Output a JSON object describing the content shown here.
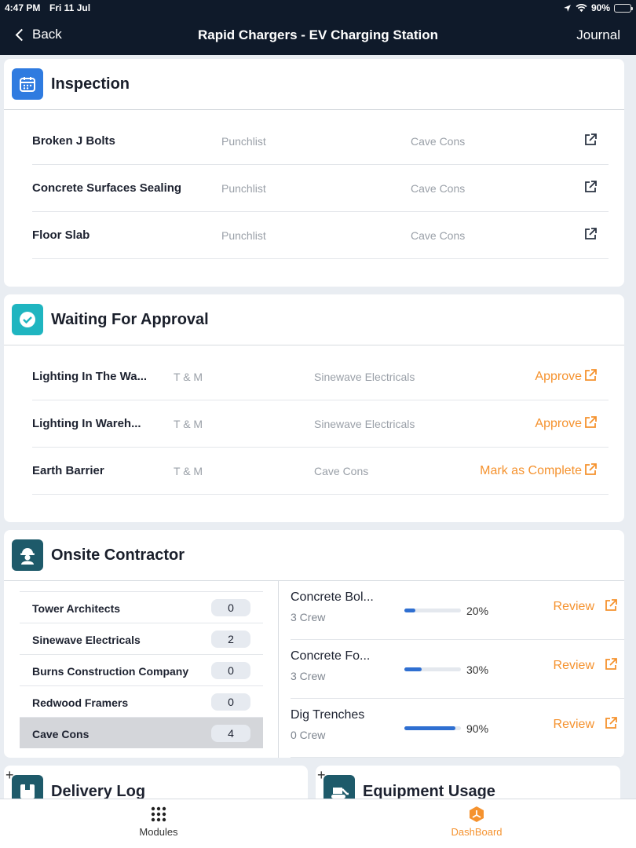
{
  "status": {
    "time": "4:47 PM",
    "date": "Fri 11 Jul",
    "battery": "90%"
  },
  "nav": {
    "back": "Back",
    "title": "Rapid Chargers - EV Charging Station",
    "journal": "Journal"
  },
  "inspection": {
    "title": "Inspection",
    "rows": [
      {
        "name": "Broken J Bolts",
        "type": "Punchlist",
        "company": "Cave Cons"
      },
      {
        "name": "Concrete Surfaces Sealing",
        "type": "Punchlist",
        "company": "Cave Cons"
      },
      {
        "name": "Floor Slab",
        "type": "Punchlist",
        "company": "Cave Cons"
      }
    ]
  },
  "approval": {
    "title": "Waiting For Approval",
    "rows": [
      {
        "name": "Lighting In The Wa...",
        "type": "T & M",
        "company": "Sinewave Electricals",
        "action": "Approve"
      },
      {
        "name": "Lighting In Wareh...",
        "type": "T & M",
        "company": "Sinewave Electricals",
        "action": "Approve"
      },
      {
        "name": "Earth Barrier",
        "type": "T & M",
        "company": "Cave Cons",
        "action": "Mark as Complete"
      }
    ]
  },
  "onsite": {
    "title": "Onsite Contractor",
    "contractors": [
      {
        "name": "Tower Architects",
        "count": "0"
      },
      {
        "name": "Sinewave Electricals",
        "count": "2"
      },
      {
        "name": "Burns Construction Company",
        "count": "0"
      },
      {
        "name": "Redwood Framers",
        "count": "0"
      },
      {
        "name": "Cave Cons",
        "count": "4"
      }
    ],
    "tasks": [
      {
        "name": "Concrete Bol...",
        "crew": "3 Crew",
        "progress": 20,
        "progress_label": "20%",
        "action": "Review"
      },
      {
        "name": "Concrete Fo...",
        "crew": "3 Crew",
        "progress": 30,
        "progress_label": "30%",
        "action": "Review"
      },
      {
        "name": "Dig Trenches",
        "crew": "0 Crew",
        "progress": 90,
        "progress_label": "90%",
        "action": "Review"
      }
    ]
  },
  "delivery": {
    "title": "Delivery Log"
  },
  "equipment": {
    "title": "Equipment Usage"
  },
  "tabs": {
    "modules": "Modules",
    "dashboard": "DashBoard"
  },
  "colors": {
    "nav_bg": "#0f1a2a",
    "accent": "#f5922e",
    "inspection_icon": "#2f7be0",
    "approval_icon": "#1fb5c0",
    "contractor_icon": "#1e5a6a",
    "progress": "#2f6fd1"
  }
}
